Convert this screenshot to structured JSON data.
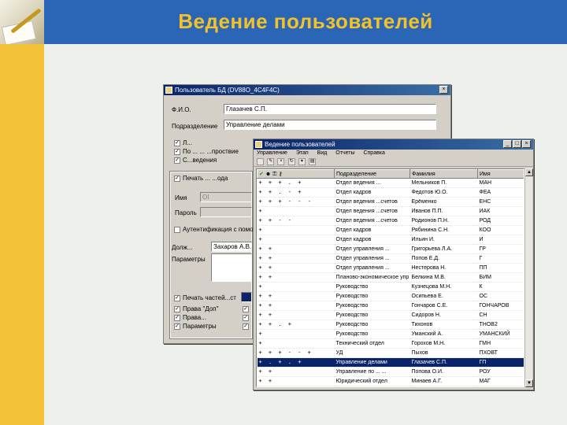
{
  "slide": {
    "title": "Ведение пользователей"
  },
  "props_window": {
    "title": "Пользователь БД   (DV88O_4C4F4C)",
    "fio_label": "Ф.И.О.",
    "fio_value": "Глазачев С.П.",
    "dept_label": "Подразделение",
    "dept_value": "Управление делами",
    "check1": "Л...",
    "check2": "По ... ... ...проствие",
    "check3": "С...ведения",
    "section_label": "Печать ... ...ода",
    "name_label": "Имя",
    "name_value": "ОI",
    "password_label": "Пароль",
    "auth_label": "Аутентификация с помо",
    "post_label": "Долж...",
    "post_value": "Захаров А.В.",
    "params_label": "Параметры",
    "bottom_check": "Печать частей...ст",
    "opt1": "Права \"Доп\"",
    "opt2": "Права...",
    "opt3": "Параметры"
  },
  "list_window": {
    "title": "Ведение пользователей",
    "menu": [
      "Управление",
      "Этап",
      "Вид",
      "Отчеты",
      "Справка"
    ],
    "columns": [
      "",
      "Подразделение",
      "Фамилия",
      "Имя"
    ],
    "rows": [
      {
        "flags": "+ + + . +",
        "dept": "Отдел ведения ...",
        "name": "Мельников П.",
        "login": "МАН",
        "selected": false
      },
      {
        "flags": "+ + . - +",
        "dept": "Отдел кадров",
        "name": "Федотов Ю.О.",
        "login": "ФЕА",
        "selected": false
      },
      {
        "flags": "+ + + - - -",
        "dept": "Отдел ведения ...счетов",
        "name": "Ерёменко",
        "login": "ЕНС",
        "selected": false
      },
      {
        "flags": "+",
        "dept": "Отдел ведения ...счетов",
        "name": "Иванов П.П.",
        "login": "ИАК",
        "selected": false
      },
      {
        "flags": "+ + - -",
        "dept": "Отдел ведения ...счетов",
        "name": "Родионов П.Н.",
        "login": "РОД",
        "selected": false
      },
      {
        "flags": "+",
        "dept": "Отдел кадров",
        "name": "Рябинина С.Н.",
        "login": "КОО",
        "selected": false
      },
      {
        "flags": "+",
        "dept": "Отдел кадров",
        "name": "Ильин И.",
        "login": "И",
        "selected": false
      },
      {
        "flags": "+ +",
        "dept": "Отдел управления ...",
        "name": "Григорьева Л.А.",
        "login": "ГР",
        "selected": false
      },
      {
        "flags": "+ +",
        "dept": "Отдел управления ...",
        "name": "Попов Е.Д.",
        "login": "Г",
        "selected": false
      },
      {
        "flags": "+ +",
        "dept": "Отдел управления ...",
        "name": "Нестерова Н.",
        "login": "ПП",
        "selected": false
      },
      {
        "flags": "+ +",
        "dept": "Планово-экономическое упр",
        "name": "Белкина М.В.",
        "login": "БИМ",
        "selected": false
      },
      {
        "flags": "+",
        "dept": "Руководство",
        "name": "Кузнецова М.Н.",
        "login": "К",
        "selected": false
      },
      {
        "flags": "+ +",
        "dept": "Руководство",
        "name": "Осипьева Е.",
        "login": "ОС",
        "selected": false
      },
      {
        "flags": "+ +",
        "dept": "Руководство",
        "name": "Гончаров С.Е.",
        "login": "ГОНЧАРОВ",
        "selected": false
      },
      {
        "flags": "+ +",
        "dept": "Руководство",
        "name": "Сидоров Н.",
        "login": "СН",
        "selected": false
      },
      {
        "flags": "+ + . +",
        "dept": "Руководство",
        "name": "Тихонов",
        "login": "ТНОВ2",
        "selected": false
      },
      {
        "flags": "+",
        "dept": "Руководство",
        "name": "Уманский А.",
        "login": "УМАНСКИЙ",
        "selected": false
      },
      {
        "flags": "+",
        "dept": "Технический отдел",
        "name": "Горохов М.Н.",
        "login": "ГМН",
        "selected": false
      },
      {
        "flags": "+ + + - - +",
        "dept": "УД",
        "name": "Пыхов",
        "login": "ПХОВТ",
        "selected": false
      },
      {
        "flags": "+ . + . +",
        "dept": "Управление делами",
        "name": "Глазачев С.П.",
        "login": "ГП",
        "selected": true
      },
      {
        "flags": "+ +",
        "dept": "Управление по ... ...",
        "name": "Попова О.И.",
        "login": "РОУ",
        "selected": false
      },
      {
        "flags": "+ +",
        "dept": "Юридический отдел",
        "name": "Минаев А.Г.",
        "login": "МАГ",
        "selected": false
      }
    ]
  }
}
